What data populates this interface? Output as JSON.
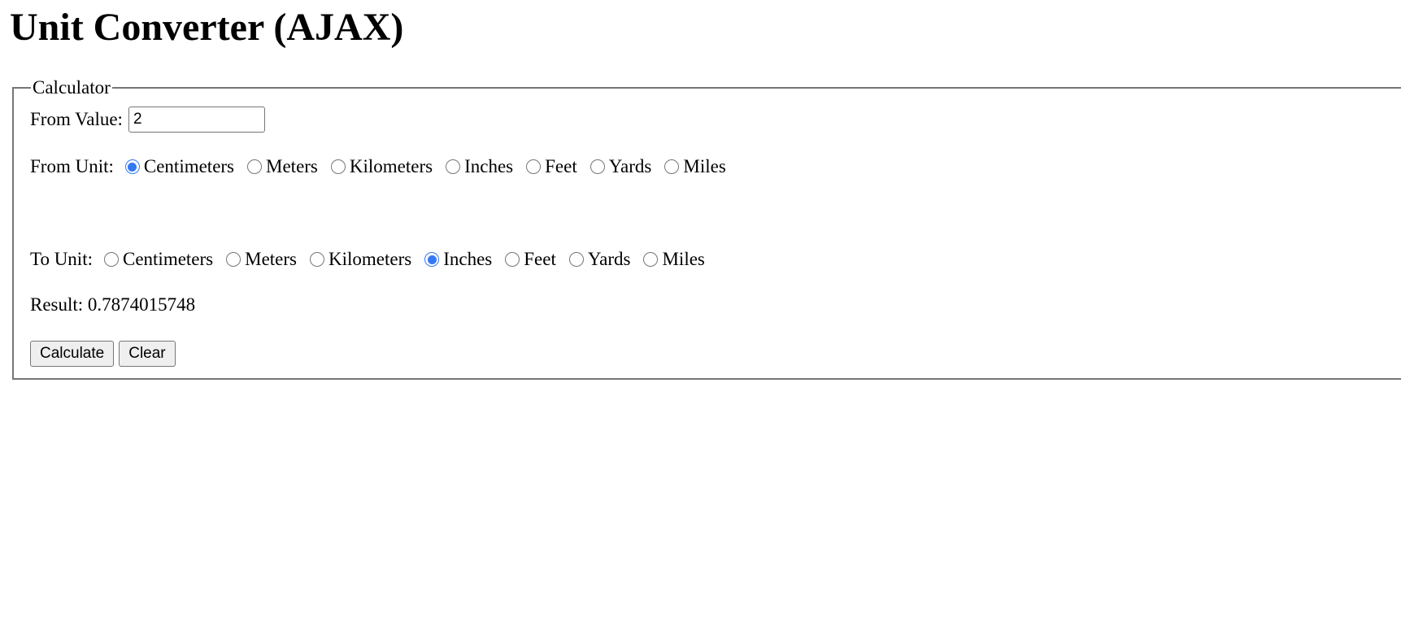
{
  "page": {
    "title": "Unit Converter (AJAX)"
  },
  "calculator": {
    "legend": "Calculator",
    "from_value": {
      "label": "From Value:",
      "value": "2"
    },
    "from_unit": {
      "label": "From Unit:",
      "options": [
        "Centimeters",
        "Meters",
        "Kilometers",
        "Inches",
        "Feet",
        "Yards",
        "Miles"
      ],
      "selected": "Centimeters"
    },
    "to_unit": {
      "label": "To Unit:",
      "options": [
        "Centimeters",
        "Meters",
        "Kilometers",
        "Inches",
        "Feet",
        "Yards",
        "Miles"
      ],
      "selected": "Inches"
    },
    "result": {
      "text": "Result: 0.7874015748"
    },
    "buttons": {
      "calculate": "Calculate",
      "clear": "Clear"
    }
  },
  "colors": {
    "radio_accent": "#3478f6",
    "border": "#767676",
    "button_bg": "#efefef"
  }
}
